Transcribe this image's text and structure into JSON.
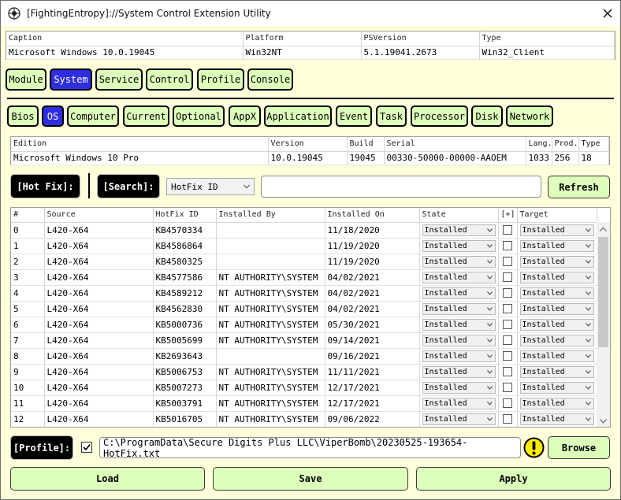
{
  "window": {
    "title": "[FightingEntropy]://System Control Extension Utility"
  },
  "system_grid": {
    "headers": [
      "Caption",
      "Platform",
      "PSVersion",
      "Type"
    ],
    "row": [
      "Microsoft Windows 10.0.19045",
      "Win32NT",
      "5.1.19041.2673",
      "Win32_Client"
    ]
  },
  "main_tabs": [
    {
      "label": "Module",
      "active": false
    },
    {
      "label": "System",
      "active": true
    },
    {
      "label": "Service",
      "active": false
    },
    {
      "label": "Control",
      "active": false
    },
    {
      "label": "Profile",
      "active": false
    },
    {
      "label": "Console",
      "active": false
    }
  ],
  "sub_tabs": [
    {
      "label": "Bios",
      "active": false
    },
    {
      "label": "OS",
      "active": true
    },
    {
      "label": "Computer",
      "active": false
    },
    {
      "label": "Current",
      "active": false
    },
    {
      "label": "Optional",
      "active": false
    },
    {
      "label": "AppX",
      "active": false
    },
    {
      "label": "Application",
      "active": false
    },
    {
      "label": "Event",
      "active": false
    },
    {
      "label": "Task",
      "active": false
    },
    {
      "label": "Processor",
      "active": false
    },
    {
      "label": "Disk",
      "active": false
    },
    {
      "label": "Network",
      "active": false
    }
  ],
  "os_grid": {
    "headers": [
      "Edition",
      "Version",
      "Build",
      "Serial",
      "Lang.",
      "Prod.",
      "Type"
    ],
    "row": [
      "Microsoft Windows 10 Pro",
      "10.0.19045",
      "19045",
      "00330-50000-00000-AAOEM",
      "1033",
      "256",
      "18"
    ]
  },
  "hotfix_bar": {
    "hotfix_label": "[Hot Fix]:",
    "search_label": "[Search]:",
    "search_property": "HotFix ID",
    "search_value": "",
    "refresh_label": "Refresh"
  },
  "hotfix_grid": {
    "headers": [
      "#",
      "Source",
      "HotFix ID",
      "Installed By",
      "Installed On",
      "State",
      "[+]",
      "Target"
    ],
    "rows": [
      {
        "index": "0",
        "source": "L420-X64",
        "id": "KB4570334",
        "by": "",
        "on": "11/18/2020",
        "state": "Installed",
        "target": "Installed"
      },
      {
        "index": "1",
        "source": "L420-X64",
        "id": "KB4586864",
        "by": "",
        "on": "11/19/2020",
        "state": "Installed",
        "target": "Installed"
      },
      {
        "index": "2",
        "source": "L420-X64",
        "id": "KB4580325",
        "by": "",
        "on": "11/19/2020",
        "state": "Installed",
        "target": "Installed"
      },
      {
        "index": "3",
        "source": "L420-X64",
        "id": "KB4577586",
        "by": "NT AUTHORITY\\SYSTEM",
        "on": "04/02/2021",
        "state": "Installed",
        "target": "Installed"
      },
      {
        "index": "4",
        "source": "L420-X64",
        "id": "KB4589212",
        "by": "NT AUTHORITY\\SYSTEM",
        "on": "04/02/2021",
        "state": "Installed",
        "target": "Installed"
      },
      {
        "index": "5",
        "source": "L420-X64",
        "id": "KB4562830",
        "by": "NT AUTHORITY\\SYSTEM",
        "on": "04/02/2021",
        "state": "Installed",
        "target": "Installed"
      },
      {
        "index": "6",
        "source": "L420-X64",
        "id": "KB5000736",
        "by": "NT AUTHORITY\\SYSTEM",
        "on": "05/30/2021",
        "state": "Installed",
        "target": "Installed"
      },
      {
        "index": "7",
        "source": "L420-X64",
        "id": "KB5005699",
        "by": "NT AUTHORITY\\SYSTEM",
        "on": "09/14/2021",
        "state": "Installed",
        "target": "Installed"
      },
      {
        "index": "8",
        "source": "L420-X64",
        "id": "KB2693643",
        "by": "",
        "on": "09/16/2021",
        "state": "Installed",
        "target": "Installed"
      },
      {
        "index": "9",
        "source": "L420-X64",
        "id": "KB5006753",
        "by": "NT AUTHORITY\\SYSTEM",
        "on": "11/11/2021",
        "state": "Installed",
        "target": "Installed"
      },
      {
        "index": "10",
        "source": "L420-X64",
        "id": "KB5007273",
        "by": "NT AUTHORITY\\SYSTEM",
        "on": "12/17/2021",
        "state": "Installed",
        "target": "Installed"
      },
      {
        "index": "11",
        "source": "L420-X64",
        "id": "KB5003791",
        "by": "NT AUTHORITY\\SYSTEM",
        "on": "12/17/2021",
        "state": "Installed",
        "target": "Installed"
      },
      {
        "index": "12",
        "source": "L420-X64",
        "id": "KB5016705",
        "by": "NT AUTHORITY\\SYSTEM",
        "on": "09/06/2022",
        "state": "Installed",
        "target": "Installed"
      }
    ]
  },
  "profile_bar": {
    "label": "[Profile]:",
    "checked": true,
    "path": "C:\\ProgramData\\Secure Digits Plus LLC\\ViperBomb\\20230525-193654-HotFix.txt",
    "warning_icon": "exclamation-warning-icon",
    "browse_label": "Browse"
  },
  "footer": {
    "load_label": "Load",
    "save_label": "Save",
    "apply_label": "Apply"
  },
  "colors": {
    "window_bg": "#ffffdc",
    "button_bg": "#ddffbb",
    "active_tab": "#2e2ee0",
    "warning": "#ffee00"
  }
}
